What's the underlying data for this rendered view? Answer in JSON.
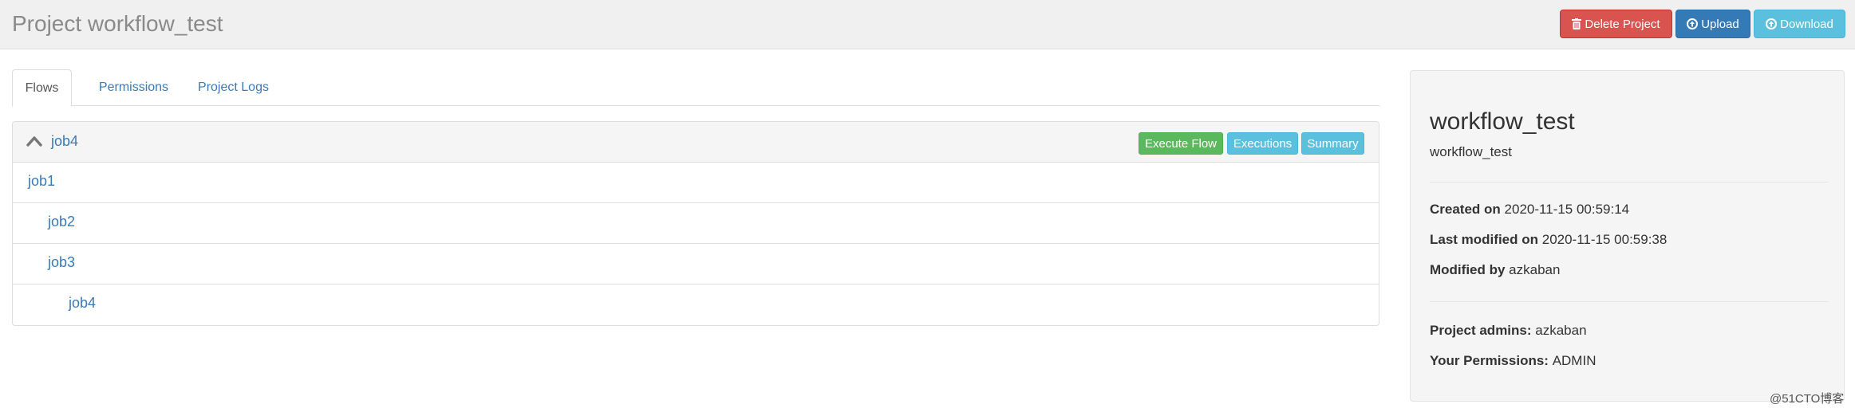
{
  "header": {
    "title": "Project workflow_test",
    "buttons": {
      "delete": "Delete Project",
      "upload": "Upload",
      "download": "Download"
    }
  },
  "tabs": [
    {
      "label": "Flows",
      "active": true
    },
    {
      "label": "Permissions",
      "active": false
    },
    {
      "label": "Project Logs",
      "active": false
    }
  ],
  "flow": {
    "name": "job4",
    "buttons": {
      "execute": "Execute Flow",
      "executions": "Executions",
      "summary": "Summary"
    },
    "jobs": [
      {
        "name": "job1",
        "level": 0
      },
      {
        "name": "job2",
        "level": 1
      },
      {
        "name": "job3",
        "level": 1
      },
      {
        "name": "job4",
        "level": 2
      }
    ]
  },
  "project_info": {
    "name": "workflow_test",
    "description": "workflow_test",
    "created_label": "Created on",
    "created_value": "2020-11-15 00:59:14",
    "modified_label": "Last modified on",
    "modified_value": "2020-11-15 00:59:38",
    "modified_by_label": "Modified by",
    "modified_by_value": "azkaban",
    "admins_label": "Project admins:",
    "admins_value": "azkaban",
    "permissions_label": "Your Permissions:",
    "permissions_value": "ADMIN"
  },
  "watermark": "@51CTO博客",
  "colors": {
    "danger": "#d9534f",
    "primary": "#337ab7",
    "info": "#5bc0de",
    "success": "#5cb85c",
    "link": "#3a7ab8"
  },
  "icons": {
    "delete": "trash-icon",
    "upload": "arrow-circle-up-icon",
    "download": "arrow-circle-down-icon",
    "collapse": "chevron-up-icon"
  }
}
